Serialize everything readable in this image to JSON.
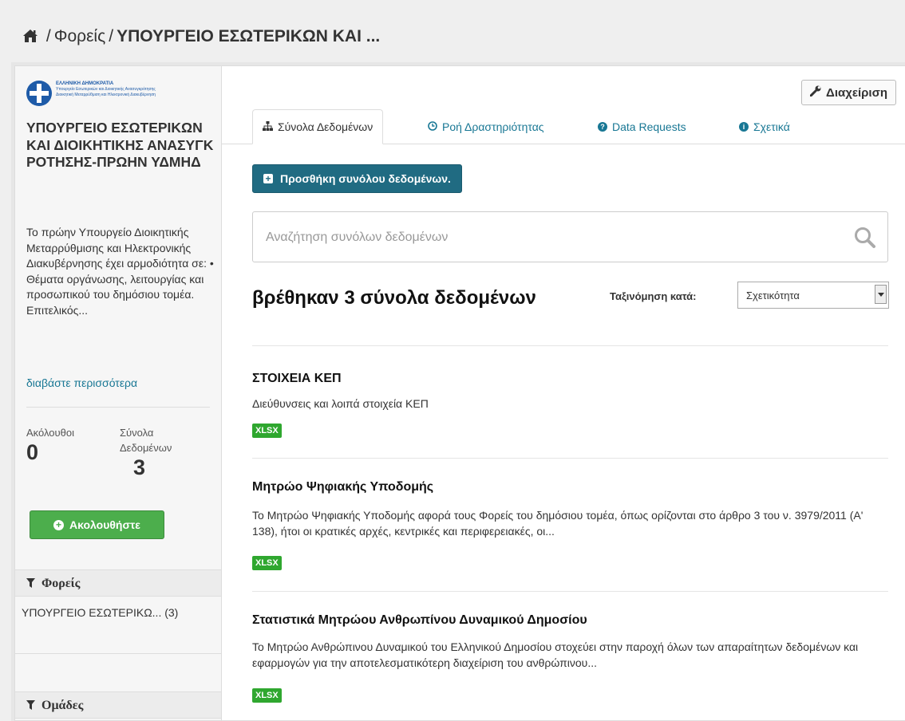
{
  "breadcrumb": {
    "home_icon": "home-icon",
    "separator": "/",
    "parent": "Φορείς",
    "current": "ΥΠΟΥΡΓΕΙΟ ΕΣΩΤΕΡΙΚΩΝ ΚΑΙ ..."
  },
  "sidebar": {
    "logo": {
      "line1": "ΕΛΛΗΝΙΚΗ ΔΗΜΟΚΡΑΤΙΑ",
      "line2": "Υπουργείο Εσωτερικών και Διοικητικής Ανασυγκρότησης",
      "line3": "Διοικητική Μεταρρύθμιση και Ηλεκτρονική Διακυβέρνηση"
    },
    "org_title": "ΥΠΟΥΡΓΕΙΟ ΕΣΩΤΕΡΙΚΩΝ ΚΑΙ ΔΙΟΙΚΗΤΙΚΗΣ ΑΝΑΣΥΓΚΡΟΤΗΣΗΣ-ΠΡΩΗΝ ΥΔΜΗΔ",
    "description": "Το πρώην Υπουργείο Διοικητικής Μεταρρύθμισης και Ηλεκτρονικής Διακυβέρνησης έχει αρμοδιότητα σε: • Θέματα οργάνωσης, λειτουργίας και προσωπικού του δημόσιου τομέα. Επιτελικός...",
    "read_more": "διαβάστε περισσότερα",
    "followers_label": "Ακόλουθοι",
    "followers_value": "0",
    "datasets_label": "Σύνολα Δεδομένων",
    "datasets_value": "3",
    "follow_button": "Ακολουθήστε",
    "facets": {
      "orgs_title": "Φορείς",
      "orgs_item": "ΥΠΟΥΡΓΕΙΟ ΕΣΩΤΕΡΙΚΩ... (3)",
      "groups_title": "Ομάδες"
    }
  },
  "main": {
    "manage_button": "Διαχείριση",
    "tabs": [
      {
        "label": "Σύνολα Δεδομένων",
        "icon": "sitemap-icon",
        "active": true
      },
      {
        "label": "Ροή Δραστηριότητας",
        "icon": "clock-icon"
      },
      {
        "label": "Data Requests",
        "icon": "question-icon"
      },
      {
        "label": "Σχετικά",
        "icon": "info-icon"
      }
    ],
    "add_button": "Προσθήκη συνόλου δεδομένων.",
    "search_placeholder": "Αναζήτηση συνόλων δεδομένων",
    "results_title": "βρέθηκαν 3 σύνολα δεδομένων",
    "sort_label": "Ταξινόμηση κατά:",
    "sort_value": "Σχετικότητα",
    "datasets": [
      {
        "title": "ΣΤΟΙΧΕΙΑ ΚΕΠ",
        "description": "Διεύθυνσεις και λοιπά στοιχεία ΚΕΠ",
        "format": "XLSX"
      },
      {
        "title": "Μητρώο Ψηφιακής Υποδομής",
        "description": "Το Μητρώο Ψηφιακής Υποδομής αφορά τους Φορείς του δημόσιου τομέα, όπως ορίζονται στο άρθρο 3 του ν. 3979/2011 (Α' 138), ήτοι οι κρατικές αρχές, κεντρικές και περιφερειακές, οι...",
        "format": "XLSX"
      },
      {
        "title": "Στατιστικά Μητρώου Ανθρωπίνου Δυναμικού Δημοσίου",
        "description": "Το Μητρώο Ανθρώπινου Δυναμικού του Ελληνικού Δημοσίου στοχεύει στην παροχή όλων των απαραίτητων δεδομένων και εφαρμογών για την αποτελεσματικότερη διαχείριση του ανθρώπινου...",
        "format": "XLSX"
      }
    ]
  },
  "colors": {
    "link": "#187794",
    "primary_button": "#206b82",
    "follow_button": "#4cae4c",
    "format_badge": "#2fa72f"
  }
}
